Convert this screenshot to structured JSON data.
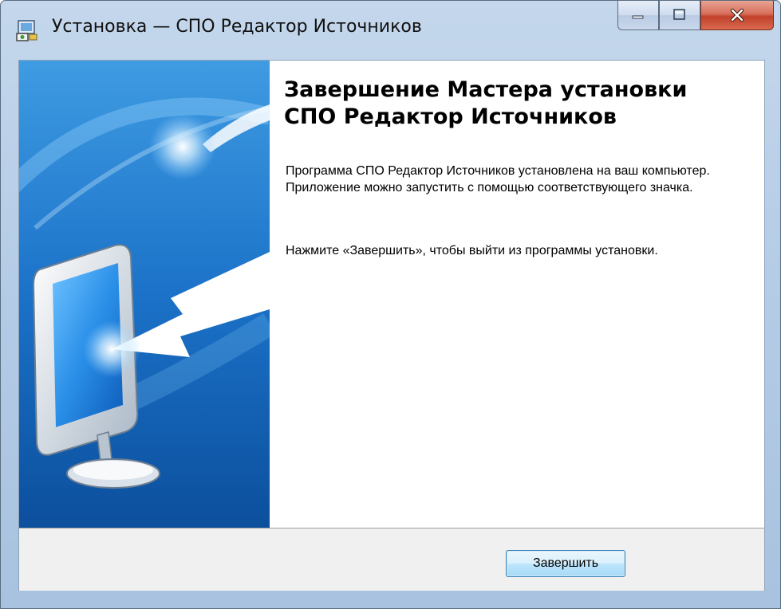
{
  "window": {
    "title": "Установка — СПО Редактор Источников"
  },
  "icons": {
    "app": "setup-icon",
    "minimize": "minimize-icon",
    "maximize": "maximize-icon",
    "close": "close-icon",
    "banner": "monitor-arrow-illustration"
  },
  "wizard": {
    "heading_line1": "Завершение Мастера установки",
    "heading_line2": "СПО Редактор Источников",
    "paragraph1": "Программа СПО Редактор Источников установлена на ваш компьютер. Приложение можно запустить с помощью соответствующего значка.",
    "paragraph2": "Нажмите «Завершить», чтобы выйти из программы установки."
  },
  "buttons": {
    "finish": "Завершить"
  },
  "colors": {
    "banner_blue": "#1a6fc4",
    "close_red": "#c2412b",
    "button_border": "#3c7fb1"
  }
}
